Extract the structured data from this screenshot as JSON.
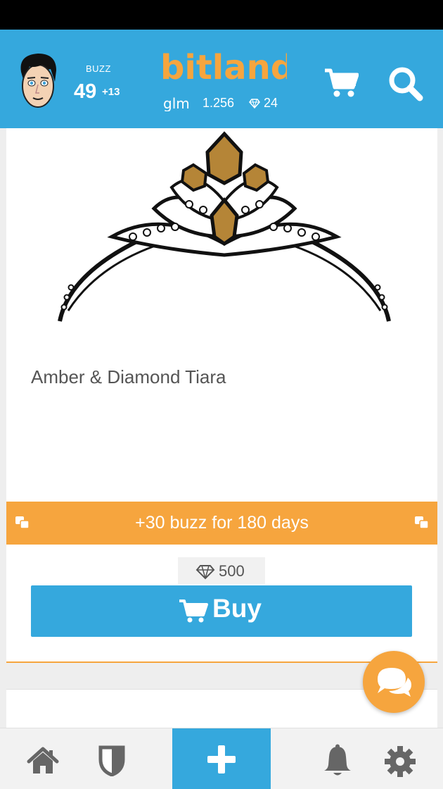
{
  "header": {
    "buzz_label": "BUZZ",
    "buzz_value": "49",
    "buzz_delta": "+13",
    "logo_text": "bitlanders",
    "glm_logo_text": "glm",
    "glm_value": "1.256",
    "gems_value": "24"
  },
  "product": {
    "title": "Amber & Diamond Tiara",
    "bonus_text": "+30 buzz for 180 days",
    "price": "500",
    "buy_label": "Buy"
  },
  "colors": {
    "brand_blue": "#35a8dd",
    "accent_orange": "#f6a53e",
    "status_black": "#000000",
    "text_gray": "#555555"
  },
  "icons": {
    "header": [
      "avatar",
      "cart-icon",
      "search-icon",
      "gem-icon"
    ],
    "bottom_nav": [
      "home-icon",
      "shield-icon",
      "plus-icon",
      "bell-icon",
      "gear-icon"
    ],
    "fab": "chat-icon"
  }
}
